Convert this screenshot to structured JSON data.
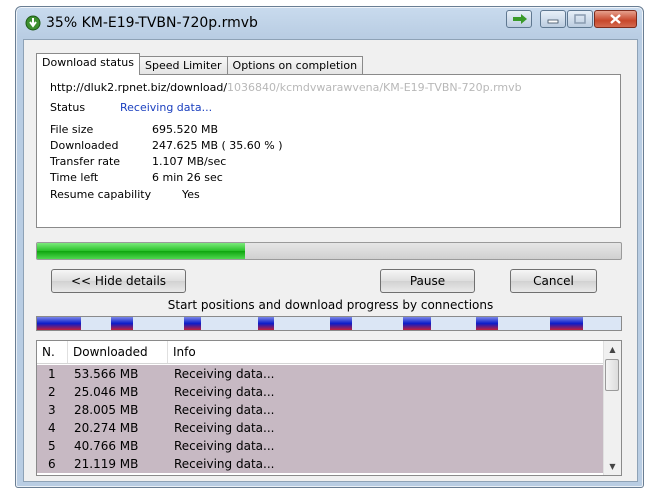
{
  "window": {
    "title": "35% KM-E19-TVBN-720p.rmvb",
    "icons": {
      "app": "download-arrow-icon",
      "goto": "arrow-right-icon",
      "minimize": "minimize-icon",
      "maximize": "maximize-icon",
      "close": "close-icon"
    }
  },
  "tabs": [
    {
      "label": "Download status",
      "active": true
    },
    {
      "label": "Speed Limiter",
      "active": false
    },
    {
      "label": "Options on completion",
      "active": false
    }
  ],
  "status_panel": {
    "url": "http://dluk2.rpnet.biz/download/",
    "url_obscured": "1036840/kcmdvwarawvena/KM-E19-TVBN-720p.rmvb",
    "status_label": "Status",
    "status_value": "Receiving data...",
    "details": [
      {
        "label": "File size",
        "value": "695.520  MB"
      },
      {
        "label": "Downloaded",
        "value": "247.625  MB  ( 35.60 % )"
      },
      {
        "label": "Transfer rate",
        "value": "1.107  MB/sec"
      },
      {
        "label": "Time left",
        "value": "6 min 26 sec"
      },
      {
        "label": "Resume capability",
        "value": "Yes"
      }
    ]
  },
  "progress": {
    "percent": 35.6
  },
  "buttons": {
    "hide_details": "<< Hide details",
    "pause": "Pause",
    "cancel": "Cancel"
  },
  "connections_title": "Start positions and download progress by connections",
  "connection_segments": [
    {
      "start": 0.0,
      "end": 0.075
    },
    {
      "start": 0.127,
      "end": 0.165
    },
    {
      "start": 0.252,
      "end": 0.28
    },
    {
      "start": 0.378,
      "end": 0.405
    },
    {
      "start": 0.502,
      "end": 0.54
    },
    {
      "start": 0.626,
      "end": 0.675
    },
    {
      "start": 0.752,
      "end": 0.79
    },
    {
      "start": 0.878,
      "end": 0.935
    }
  ],
  "table": {
    "columns": [
      "N.",
      "Downloaded",
      "Info"
    ],
    "rows": [
      {
        "n": "1",
        "downloaded": "53.566  MB",
        "info": "Receiving data..."
      },
      {
        "n": "2",
        "downloaded": "25.046  MB",
        "info": "Receiving data..."
      },
      {
        "n": "3",
        "downloaded": "28.005  MB",
        "info": "Receiving data..."
      },
      {
        "n": "4",
        "downloaded": "20.274  MB",
        "info": "Receiving data..."
      },
      {
        "n": "5",
        "downloaded": "40.766  MB",
        "info": "Receiving data..."
      },
      {
        "n": "6",
        "downloaded": "21.119  MB",
        "info": "Receiving data..."
      }
    ]
  },
  "colors": {
    "progress_fill": "#27c027",
    "status_value": "#1a3fbf",
    "row_background": "#c7b9c3",
    "connection_segment": "#0a1cc9"
  }
}
